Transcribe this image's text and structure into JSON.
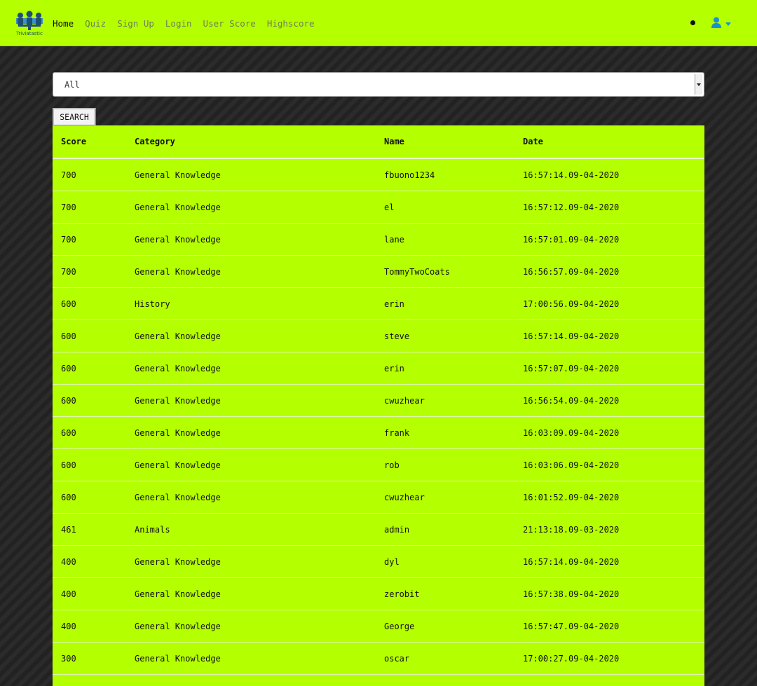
{
  "nav": {
    "brand": "Triviatastic",
    "links": [
      "Home",
      "Quiz",
      "Sign Up",
      "Login",
      "User Score",
      "Highscore"
    ]
  },
  "filter": {
    "selected": "All",
    "search_label": "SEARCH"
  },
  "table": {
    "headers": [
      "Score",
      "Category",
      "Name",
      "Date"
    ],
    "rows": [
      [
        "700",
        "General Knowledge",
        "fbuono1234",
        "16:57:14.09-04-2020"
      ],
      [
        "700",
        "General Knowledge",
        "el",
        "16:57:12.09-04-2020"
      ],
      [
        "700",
        "General Knowledge",
        "lane",
        "16:57:01.09-04-2020"
      ],
      [
        "700",
        "General Knowledge",
        "TommyTwoCoats",
        "16:56:57.09-04-2020"
      ],
      [
        "600",
        "History",
        "erin",
        "17:00:56.09-04-2020"
      ],
      [
        "600",
        "General Knowledge",
        "steve",
        "16:57:14.09-04-2020"
      ],
      [
        "600",
        "General Knowledge",
        "erin",
        "16:57:07.09-04-2020"
      ],
      [
        "600",
        "General Knowledge",
        "cwuzhear",
        "16:56:54.09-04-2020"
      ],
      [
        "600",
        "General Knowledge",
        "frank",
        "16:03:09.09-04-2020"
      ],
      [
        "600",
        "General Knowledge",
        "rob",
        "16:03:06.09-04-2020"
      ],
      [
        "600",
        "General Knowledge",
        "cwuzhear",
        "16:01:52.09-04-2020"
      ],
      [
        "461",
        "Animals",
        "admin",
        "21:13:18.09-03-2020"
      ],
      [
        "400",
        "General Knowledge",
        "dyl",
        "16:57:14.09-04-2020"
      ],
      [
        "400",
        "General Knowledge",
        "zerobit",
        "16:57:38.09-04-2020"
      ],
      [
        "400",
        "General Knowledge",
        "George",
        "16:57:47.09-04-2020"
      ],
      [
        "300",
        "General Knowledge",
        "oscar",
        "17:00:27.09-04-2020"
      ],
      [
        "",
        "",
        "",
        ""
      ]
    ]
  },
  "colors": {
    "accent": "#b4ff00",
    "icon_blue": "#1a8fd8",
    "background": "#262626"
  },
  "icons": [
    "triviatastic-logo",
    "user-icon",
    "caret-down-icon"
  ]
}
